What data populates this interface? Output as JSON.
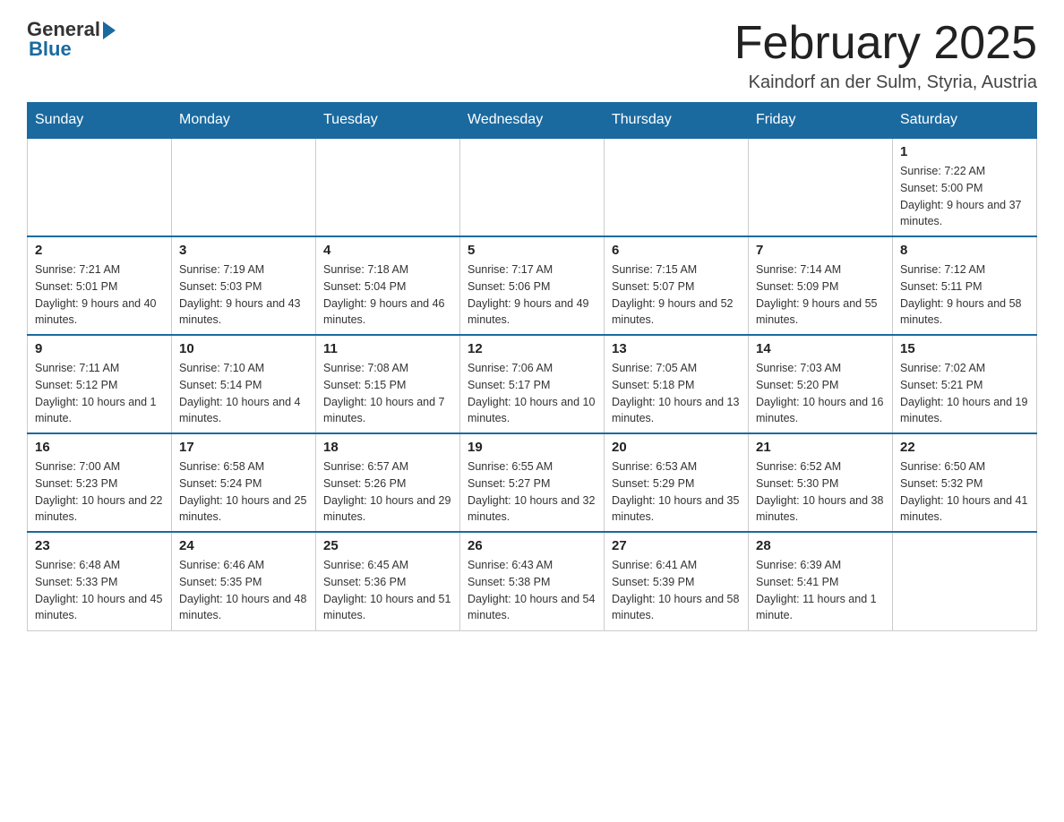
{
  "header": {
    "logo_general": "General",
    "logo_blue": "Blue",
    "month_title": "February 2025",
    "location": "Kaindorf an der Sulm, Styria, Austria"
  },
  "weekdays": [
    "Sunday",
    "Monday",
    "Tuesday",
    "Wednesday",
    "Thursday",
    "Friday",
    "Saturday"
  ],
  "weeks": [
    [
      {
        "day": "",
        "info": ""
      },
      {
        "day": "",
        "info": ""
      },
      {
        "day": "",
        "info": ""
      },
      {
        "day": "",
        "info": ""
      },
      {
        "day": "",
        "info": ""
      },
      {
        "day": "",
        "info": ""
      },
      {
        "day": "1",
        "info": "Sunrise: 7:22 AM\nSunset: 5:00 PM\nDaylight: 9 hours and 37 minutes."
      }
    ],
    [
      {
        "day": "2",
        "info": "Sunrise: 7:21 AM\nSunset: 5:01 PM\nDaylight: 9 hours and 40 minutes."
      },
      {
        "day": "3",
        "info": "Sunrise: 7:19 AM\nSunset: 5:03 PM\nDaylight: 9 hours and 43 minutes."
      },
      {
        "day": "4",
        "info": "Sunrise: 7:18 AM\nSunset: 5:04 PM\nDaylight: 9 hours and 46 minutes."
      },
      {
        "day": "5",
        "info": "Sunrise: 7:17 AM\nSunset: 5:06 PM\nDaylight: 9 hours and 49 minutes."
      },
      {
        "day": "6",
        "info": "Sunrise: 7:15 AM\nSunset: 5:07 PM\nDaylight: 9 hours and 52 minutes."
      },
      {
        "day": "7",
        "info": "Sunrise: 7:14 AM\nSunset: 5:09 PM\nDaylight: 9 hours and 55 minutes."
      },
      {
        "day": "8",
        "info": "Sunrise: 7:12 AM\nSunset: 5:11 PM\nDaylight: 9 hours and 58 minutes."
      }
    ],
    [
      {
        "day": "9",
        "info": "Sunrise: 7:11 AM\nSunset: 5:12 PM\nDaylight: 10 hours and 1 minute."
      },
      {
        "day": "10",
        "info": "Sunrise: 7:10 AM\nSunset: 5:14 PM\nDaylight: 10 hours and 4 minutes."
      },
      {
        "day": "11",
        "info": "Sunrise: 7:08 AM\nSunset: 5:15 PM\nDaylight: 10 hours and 7 minutes."
      },
      {
        "day": "12",
        "info": "Sunrise: 7:06 AM\nSunset: 5:17 PM\nDaylight: 10 hours and 10 minutes."
      },
      {
        "day": "13",
        "info": "Sunrise: 7:05 AM\nSunset: 5:18 PM\nDaylight: 10 hours and 13 minutes."
      },
      {
        "day": "14",
        "info": "Sunrise: 7:03 AM\nSunset: 5:20 PM\nDaylight: 10 hours and 16 minutes."
      },
      {
        "day": "15",
        "info": "Sunrise: 7:02 AM\nSunset: 5:21 PM\nDaylight: 10 hours and 19 minutes."
      }
    ],
    [
      {
        "day": "16",
        "info": "Sunrise: 7:00 AM\nSunset: 5:23 PM\nDaylight: 10 hours and 22 minutes."
      },
      {
        "day": "17",
        "info": "Sunrise: 6:58 AM\nSunset: 5:24 PM\nDaylight: 10 hours and 25 minutes."
      },
      {
        "day": "18",
        "info": "Sunrise: 6:57 AM\nSunset: 5:26 PM\nDaylight: 10 hours and 29 minutes."
      },
      {
        "day": "19",
        "info": "Sunrise: 6:55 AM\nSunset: 5:27 PM\nDaylight: 10 hours and 32 minutes."
      },
      {
        "day": "20",
        "info": "Sunrise: 6:53 AM\nSunset: 5:29 PM\nDaylight: 10 hours and 35 minutes."
      },
      {
        "day": "21",
        "info": "Sunrise: 6:52 AM\nSunset: 5:30 PM\nDaylight: 10 hours and 38 minutes."
      },
      {
        "day": "22",
        "info": "Sunrise: 6:50 AM\nSunset: 5:32 PM\nDaylight: 10 hours and 41 minutes."
      }
    ],
    [
      {
        "day": "23",
        "info": "Sunrise: 6:48 AM\nSunset: 5:33 PM\nDaylight: 10 hours and 45 minutes."
      },
      {
        "day": "24",
        "info": "Sunrise: 6:46 AM\nSunset: 5:35 PM\nDaylight: 10 hours and 48 minutes."
      },
      {
        "day": "25",
        "info": "Sunrise: 6:45 AM\nSunset: 5:36 PM\nDaylight: 10 hours and 51 minutes."
      },
      {
        "day": "26",
        "info": "Sunrise: 6:43 AM\nSunset: 5:38 PM\nDaylight: 10 hours and 54 minutes."
      },
      {
        "day": "27",
        "info": "Sunrise: 6:41 AM\nSunset: 5:39 PM\nDaylight: 10 hours and 58 minutes."
      },
      {
        "day": "28",
        "info": "Sunrise: 6:39 AM\nSunset: 5:41 PM\nDaylight: 11 hours and 1 minute."
      },
      {
        "day": "",
        "info": ""
      }
    ]
  ]
}
